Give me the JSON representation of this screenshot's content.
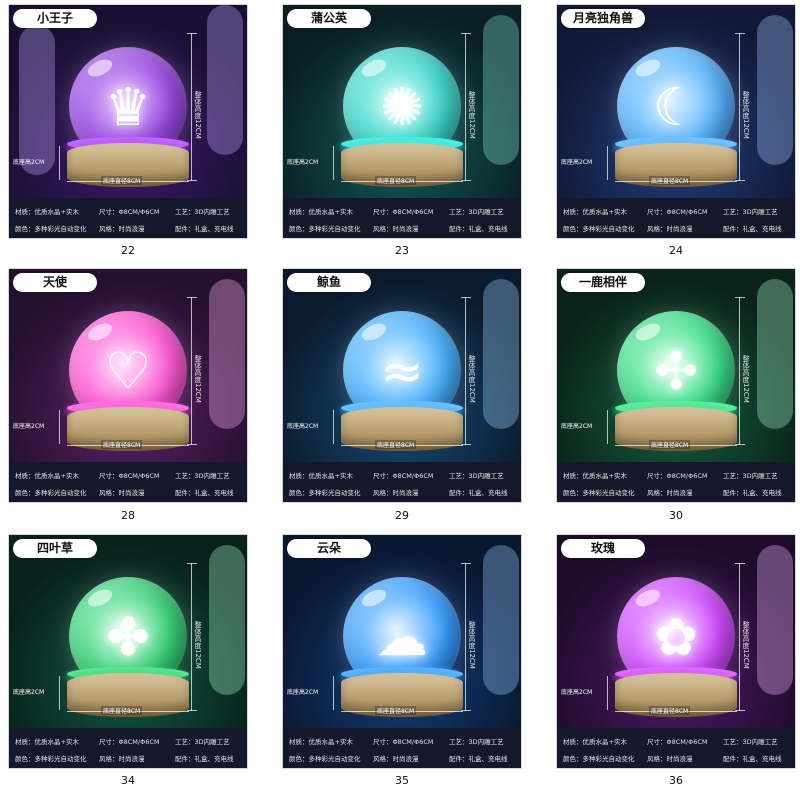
{
  "specs": {
    "material": "材质：优质水晶+实木",
    "size": "尺寸：Φ8CM/Φ6CM",
    "craft": "工艺：3D内雕工艺",
    "color": "颜色：多种彩光自动变化",
    "style": "风格：时尚浪漫",
    "accessory": "配件：礼盒、充电线"
  },
  "annotations": {
    "height": "整体高度12CM",
    "base_height": "底座高2CM",
    "base_diameter": "底座直径8CM"
  },
  "products": [
    {
      "title": "小王子",
      "number": "22",
      "glow": "#b04bff",
      "bg": "#2a1450",
      "motif": "♛"
    },
    {
      "title": "蒲公英",
      "number": "23",
      "glow": "#2fe3d6",
      "bg": "#0f3a3f",
      "motif": "✺"
    },
    {
      "title": "月亮独角兽",
      "number": "24",
      "glow": "#5ab6ff",
      "bg": "#1b2a5a",
      "motif": "☾"
    },
    {
      "title": "天使",
      "number": "28",
      "glow": "#ff5ad6",
      "bg": "#3a1446",
      "motif": "♡"
    },
    {
      "title": "鲸鱼",
      "number": "29",
      "glow": "#4ab3ff",
      "bg": "#0f2a4a",
      "motif": "≈"
    },
    {
      "title": "一鹿相伴",
      "number": "30",
      "glow": "#3de08a",
      "bg": "#0f3326",
      "motif": "✣"
    },
    {
      "title": "四叶草",
      "number": "34",
      "glow": "#39d37a",
      "bg": "#0d2e22",
      "motif": "✤"
    },
    {
      "title": "云朵",
      "number": "35",
      "glow": "#3aa0ff",
      "bg": "#0f2a52",
      "motif": "☁"
    },
    {
      "title": "玫瑰",
      "number": "36",
      "glow": "#d24bff",
      "bg": "#2a0f3e",
      "motif": "✿"
    }
  ]
}
